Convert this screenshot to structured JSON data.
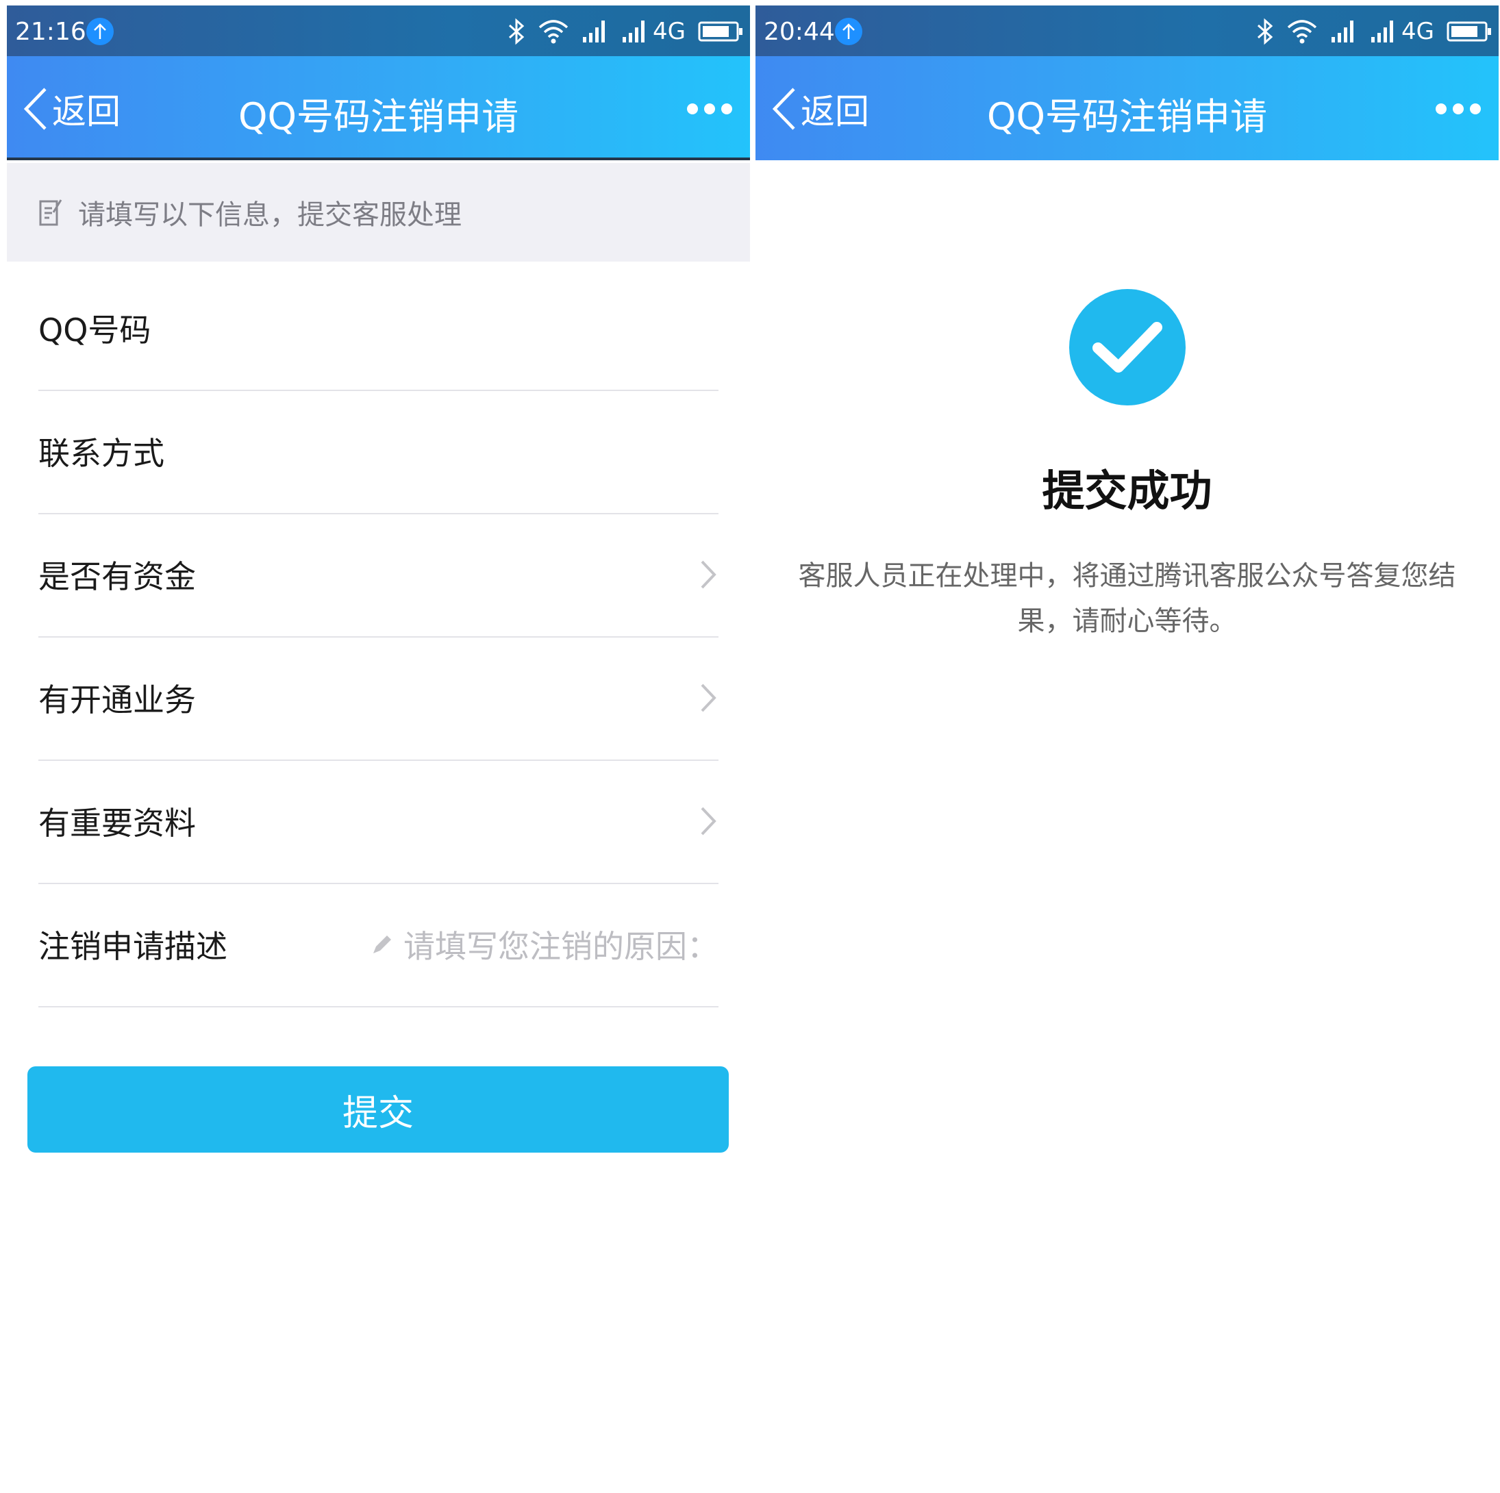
{
  "screens": [
    {
      "status": {
        "time": "21:16",
        "network": "4G"
      },
      "nav": {
        "back_label": "返回",
        "title": "QQ号码注销申请"
      },
      "hint": "请填写以下信息，提交客服处理",
      "rows": [
        {
          "label": "QQ号码"
        },
        {
          "label": "联系方式"
        },
        {
          "label": "是否有资金"
        },
        {
          "label": "有开通业务"
        },
        {
          "label": "有重要资料"
        },
        {
          "label": "注销申请描述",
          "placeholder": "请填写您注销的原因："
        }
      ],
      "submit_label": "提交"
    },
    {
      "status": {
        "time": "20:44",
        "network": "4G"
      },
      "nav": {
        "back_label": "返回",
        "title": "QQ号码注销申请"
      },
      "success": {
        "title": "提交成功",
        "message": "客服人员正在处理中，将通过腾讯客服公众号答复您结果，请耐心等待。"
      }
    }
  ],
  "colors": {
    "accent": "#20b9ee",
    "nav_start": "#3f8af2",
    "nav_end": "#23c3fb",
    "status_bar": "#2f5c9a",
    "hint_bg": "#f0f0f5",
    "divider": "#e3e3e8"
  },
  "icons": [
    "upload-icon",
    "bluetooth-icon",
    "wifi-icon",
    "signal-icon",
    "battery-icon",
    "back-chevron-icon",
    "more-icon",
    "edit-note-icon",
    "chevron-right-icon",
    "pencil-icon",
    "check-circle-icon"
  ]
}
